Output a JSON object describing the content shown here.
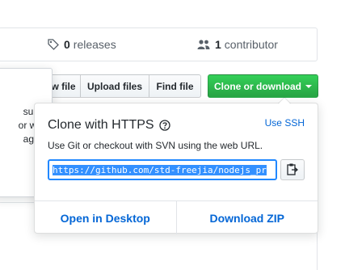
{
  "summary": {
    "releases_count": "0",
    "releases_label": "releases",
    "contributors_count": "1",
    "contributors_label": "contributor"
  },
  "toolbar": {
    "create_partial_label": "w file",
    "upload_label": "Upload files",
    "find_label": "Find file",
    "clone_label": "Clone or download"
  },
  "left_popover": {
    "lines": [
      "sume",
      "or with",
      "ages."
    ]
  },
  "clone_menu": {
    "title": "Clone with HTTPS",
    "use_ssh": "Use SSH",
    "description": "Use Git or checkout with SVN using the web URL.",
    "url": "https://github.com/std-freejia/nodejs_pr",
    "open_desktop": "Open in Desktop",
    "download_zip": "Download ZIP"
  },
  "colors": {
    "accent_green": "#28a745",
    "link_blue": "#0366d6",
    "selection_blue": "#3390ff"
  },
  "icons": {
    "releases": "tag-icon",
    "contributors": "people-icon",
    "help": "question-circle-icon",
    "copy": "clipboard-icon",
    "dropdown": "caret-down-icon"
  }
}
